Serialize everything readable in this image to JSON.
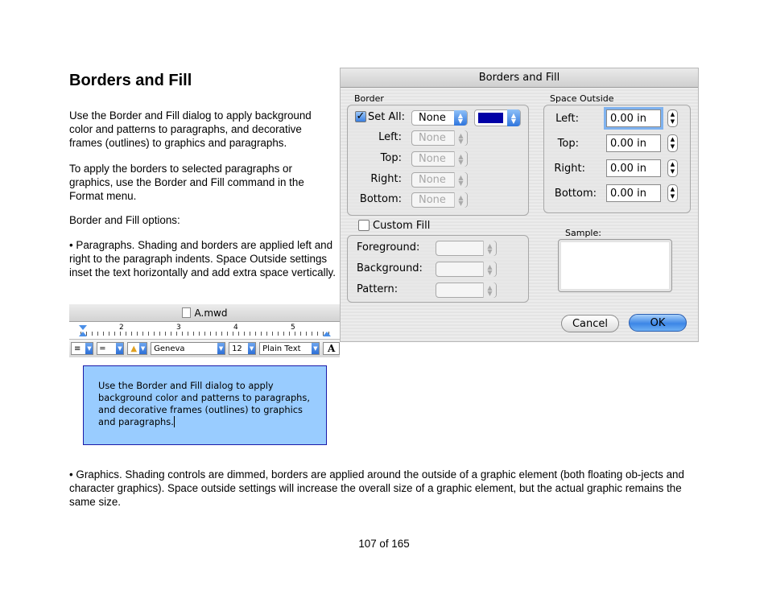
{
  "title": "Borders and Fill",
  "paragraphs": {
    "p1": "Use the Border and Fill dialog to apply background color and patterns to paragraphs, and decorative frames (outlines) to graphics and paragraphs.",
    "p2": "To apply the borders to selected paragraphs or graphics, use the Border and Fill command in the Format menu.",
    "p3": "Border and Fill options:",
    "p4": "• Paragraphs. Shading and borders are applied left and right to the paragraph indents. Space Outside settings inset the text horizontally and add extra space vertically.",
    "p5": "• Graphics. Shading controls are dimmed, borders are applied around the outside of a graphic element (both floating ob-jects and character graphics). Space outside settings will increase the overall size of a graphic element, but the actual graphic remains the same size."
  },
  "editor": {
    "window_title": "A.mwd",
    "ruler_numbers": [
      "2",
      "3",
      "4",
      "5"
    ],
    "font": "Geneva",
    "size": "12",
    "style": "Plain Text",
    "bold_glyph": "A",
    "sample_text": "Use the Border and Fill dialog to apply background color and patterns to paragraphs, and decorative frames (outlines) to graphics and paragraphs."
  },
  "dialog": {
    "title": "Borders and Fill",
    "border": {
      "group_label": "Border",
      "set_all_label": "Set All:",
      "set_all_checked": true,
      "set_all_value": "None",
      "color": "#0000a6",
      "rows": [
        {
          "label": "Left:",
          "value": "None"
        },
        {
          "label": "Top:",
          "value": "None"
        },
        {
          "label": "Right:",
          "value": "None"
        },
        {
          "label": "Bottom:",
          "value": "None"
        }
      ]
    },
    "space_outside": {
      "group_label": "Space Outside",
      "rows": [
        {
          "label": "Left:",
          "value": "0.00 in"
        },
        {
          "label": "Top:",
          "value": "0.00 in"
        },
        {
          "label": "Right:",
          "value": "0.00 in"
        },
        {
          "label": "Bottom:",
          "value": "0.00 in"
        }
      ]
    },
    "custom_fill": {
      "label": "Custom Fill",
      "checked": false,
      "rows": [
        {
          "label": "Foreground:"
        },
        {
          "label": "Background:"
        },
        {
          "label": "Pattern:"
        }
      ]
    },
    "sample_label": "Sample:",
    "cancel_label": "Cancel",
    "ok_label": "OK"
  },
  "page_number": "107 of 165"
}
